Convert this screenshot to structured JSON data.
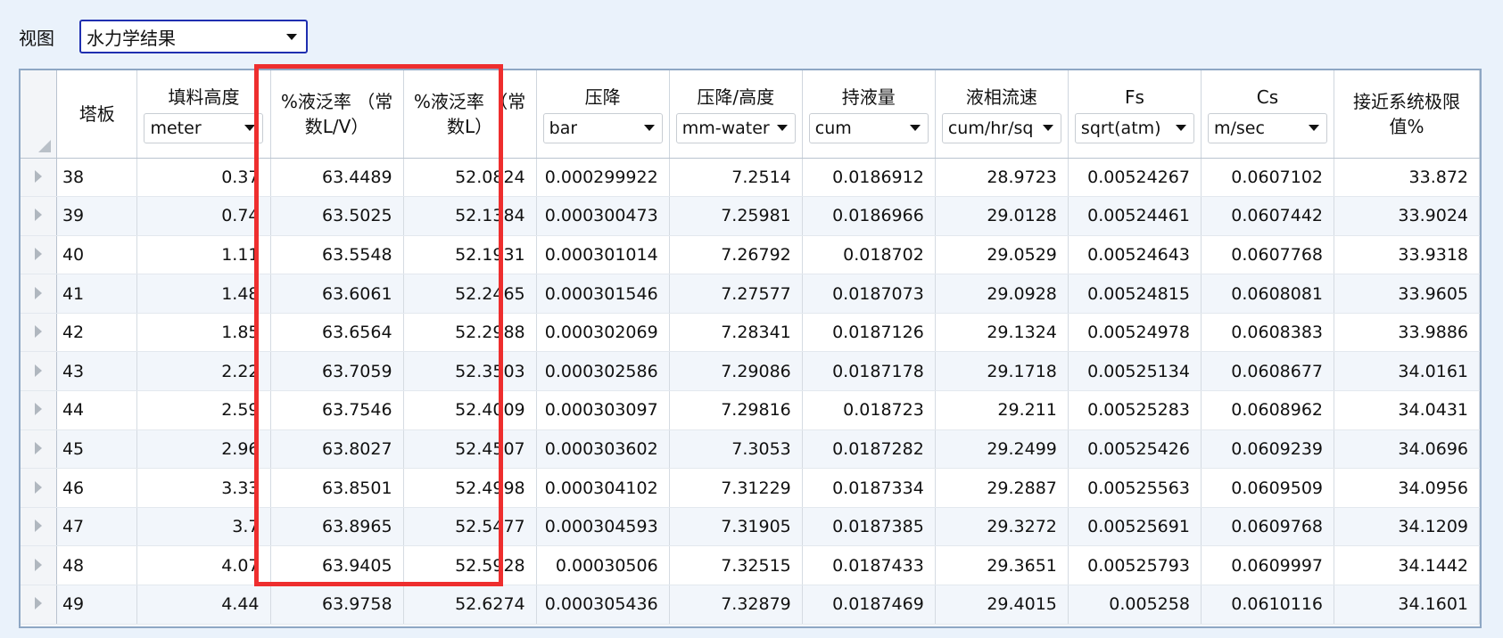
{
  "view": {
    "label": "视图",
    "selected": "水力学结果"
  },
  "columns": [
    {
      "title": "塔板",
      "unit": null
    },
    {
      "title": "填料高度",
      "unit": "meter"
    },
    {
      "title": "%液泛率 （常数L/V）",
      "unit": null
    },
    {
      "title": "%液泛率 （常数L）",
      "unit": null
    },
    {
      "title": "压降",
      "unit": "bar"
    },
    {
      "title": "压降/高度",
      "unit": "mm-water"
    },
    {
      "title": "持液量",
      "unit": "cum"
    },
    {
      "title": "液相流速",
      "unit": "cum/hr/sq"
    },
    {
      "title": "Fs",
      "unit": "sqrt(atm)"
    },
    {
      "title": "Cs",
      "unit": "m/sec"
    },
    {
      "title": "接近系统极限值%",
      "unit": null
    }
  ],
  "rows": [
    [
      "38",
      "0.37",
      "63.4489",
      "52.0824",
      "0.000299922",
      "7.2514",
      "0.0186912",
      "28.9723",
      "0.00524267",
      "0.0607102",
      "33.872"
    ],
    [
      "39",
      "0.74",
      "63.5025",
      "52.1384",
      "0.000300473",
      "7.25981",
      "0.0186966",
      "29.0128",
      "0.00524461",
      "0.0607442",
      "33.9024"
    ],
    [
      "40",
      "1.11",
      "63.5548",
      "52.1931",
      "0.000301014",
      "7.26792",
      "0.018702",
      "29.0529",
      "0.00524643",
      "0.0607768",
      "33.9318"
    ],
    [
      "41",
      "1.48",
      "63.6061",
      "52.2465",
      "0.000301546",
      "7.27577",
      "0.0187073",
      "29.0928",
      "0.00524815",
      "0.0608081",
      "33.9605"
    ],
    [
      "42",
      "1.85",
      "63.6564",
      "52.2988",
      "0.000302069",
      "7.28341",
      "0.0187126",
      "29.1324",
      "0.00524978",
      "0.0608383",
      "33.9886"
    ],
    [
      "43",
      "2.22",
      "63.7059",
      "52.3503",
      "0.000302586",
      "7.29086",
      "0.0187178",
      "29.1718",
      "0.00525134",
      "0.0608677",
      "34.0161"
    ],
    [
      "44",
      "2.59",
      "63.7546",
      "52.4009",
      "0.000303097",
      "7.29816",
      "0.018723",
      "29.211",
      "0.00525283",
      "0.0608962",
      "34.0431"
    ],
    [
      "45",
      "2.96",
      "63.8027",
      "52.4507",
      "0.000303602",
      "7.3053",
      "0.0187282",
      "29.2499",
      "0.00525426",
      "0.0609239",
      "34.0696"
    ],
    [
      "46",
      "3.33",
      "63.8501",
      "52.4998",
      "0.000304102",
      "7.31229",
      "0.0187334",
      "29.2887",
      "0.00525563",
      "0.0609509",
      "34.0956"
    ],
    [
      "47",
      "3.7",
      "63.8965",
      "52.5477",
      "0.000304593",
      "7.31905",
      "0.0187385",
      "29.3272",
      "0.00525691",
      "0.0609768",
      "34.1209"
    ],
    [
      "48",
      "4.07",
      "63.9405",
      "52.5928",
      "0.00030506",
      "7.32515",
      "0.0187433",
      "29.3651",
      "0.00525793",
      "0.0609997",
      "34.1442"
    ],
    [
      "49",
      "4.44",
      "63.9758",
      "52.6274",
      "0.000305436",
      "7.32879",
      "0.0187469",
      "29.4015",
      "0.005258",
      "0.0610116",
      "34.1601"
    ]
  ],
  "colors": {
    "highlight": "#ee2e2e",
    "select_border": "#1f2fb0",
    "background": "#eaf2fb"
  }
}
